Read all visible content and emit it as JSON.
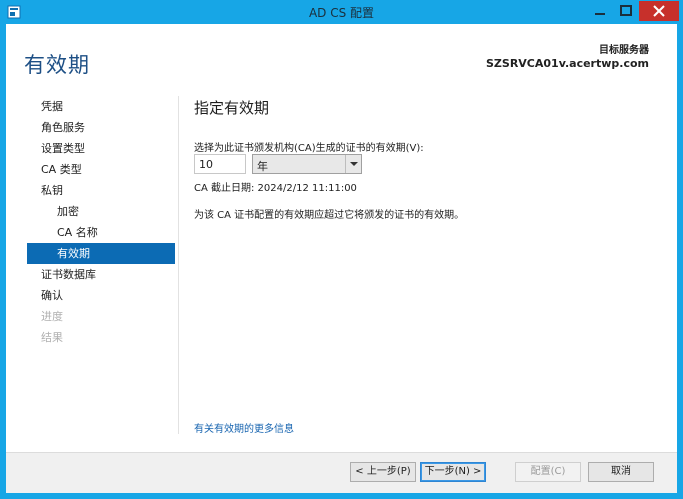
{
  "window": {
    "title": "AD CS 配置"
  },
  "header": {
    "page_title": "有效期",
    "target_label": "目标服务器",
    "target_value": "SZSRVCA01v.acertwp.com"
  },
  "nav": {
    "items": [
      {
        "label": "凭据",
        "state": "normal"
      },
      {
        "label": "角色服务",
        "state": "normal"
      },
      {
        "label": "设置类型",
        "state": "normal"
      },
      {
        "label": "CA 类型",
        "state": "normal"
      },
      {
        "label": "私钥",
        "state": "normal"
      },
      {
        "label": "加密",
        "state": "normal"
      },
      {
        "label": "CA 名称",
        "state": "normal"
      },
      {
        "label": "有效期",
        "state": "active"
      },
      {
        "label": "证书数据库",
        "state": "normal"
      },
      {
        "label": "确认",
        "state": "normal"
      },
      {
        "label": "进度",
        "state": "disabled"
      },
      {
        "label": "结果",
        "state": "disabled"
      }
    ]
  },
  "main": {
    "section_title": "指定有效期",
    "prompt": "选择为此证书颁发机构(CA)生成的证书的有效期(V):",
    "period_value": "10",
    "period_unit": "年",
    "expiration": "CA 截止日期: 2024/2/12 11:11:00",
    "note": "为该 CA 证书配置的有效期应超过它将颁发的证书的有效期。",
    "more_info_link": "有关有效期的更多信息"
  },
  "footer": {
    "prev_label": "< 上一步(P)",
    "next_label": "下一步(N) >",
    "configure_label": "配置(C)",
    "cancel_label": "取消"
  },
  "colors": {
    "frame": "#17a6e6",
    "title_accent": "#1d4f85",
    "nav_active": "#0c6bb4",
    "close_button": "#c7302b",
    "link": "#1764b0"
  }
}
